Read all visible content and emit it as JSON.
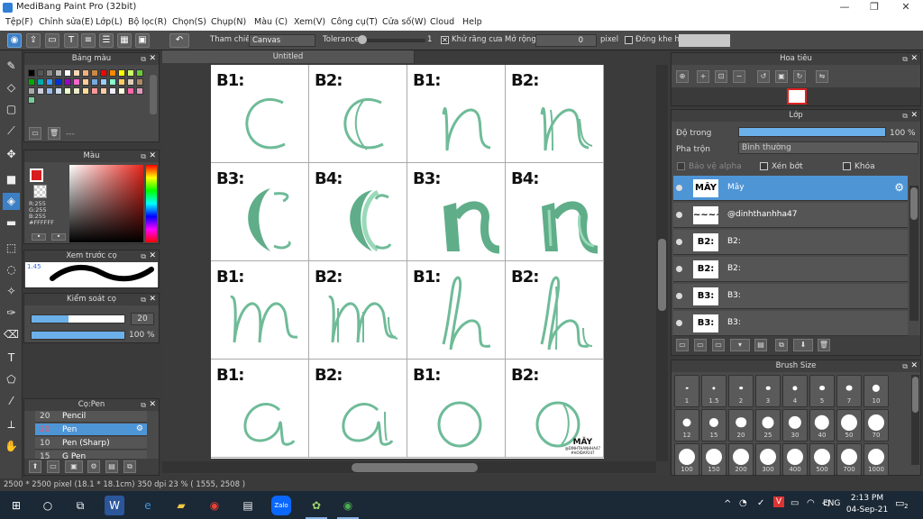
{
  "window": {
    "title": "MediBang Paint Pro (32bit)",
    "min": "—",
    "max": "❐",
    "close": "✕"
  },
  "menu": [
    "Tệp(F)",
    "Chỉnh sửa(E)",
    "Lớp(L)",
    "Bộ lọc(R)",
    "Chọn(S)",
    "Chụp(N)",
    "Màu (C)",
    "Xem(V)",
    "Công cụ(T)",
    "Cửa số(W)",
    "Cloud",
    "Help"
  ],
  "toolbar": {
    "reference_label": "Tham chiếu",
    "reference_value": "Canvas",
    "tolerance_label": "Tolerance",
    "tolerance_value": "1",
    "antialias_label": "Khử răng cưa",
    "expand_label": "Mở rộng",
    "expand_value": "0",
    "expand_unit": "pixel",
    "close_gap_label": "Đóng khe hở"
  },
  "palette_panel": {
    "title": "Bảng màu",
    "footer": "---"
  },
  "color_panel": {
    "title": "Màu",
    "r": "R:255",
    "g": "G:255",
    "b": "B:255",
    "hex": "#FFFFFF",
    "primary_color": "#d81e1e"
  },
  "brush_preview": {
    "title": "Xem trước cọ",
    "size": "1.45"
  },
  "brush_control": {
    "title": "Kiểm soát cọ",
    "size": "20",
    "opacity": "100 %",
    "size_fill": 0.4,
    "opacity_fill": 1.0
  },
  "brush_list": {
    "title": "Cọ:Pen",
    "items": [
      {
        "size": "20",
        "name": "Pencil",
        "selected": false
      },
      {
        "size": "20",
        "name": "Pen",
        "selected": true
      },
      {
        "size": "10",
        "name": "Pen (Sharp)",
        "selected": false
      },
      {
        "size": "15",
        "name": "G Pen",
        "selected": false
      }
    ]
  },
  "document": {
    "tab": "Untitled"
  },
  "canvas": {
    "cells": [
      {
        "label": "B1:",
        "glyph": "c1"
      },
      {
        "label": "B2:",
        "glyph": "c2"
      },
      {
        "label": "B1:",
        "glyph": "n1"
      },
      {
        "label": "B2:",
        "glyph": "n2"
      },
      {
        "label": "B3:",
        "glyph": "c3"
      },
      {
        "label": "B4:",
        "glyph": "c4"
      },
      {
        "label": "B3:",
        "glyph": "n3"
      },
      {
        "label": "B4:",
        "glyph": "n4"
      },
      {
        "label": "B1:",
        "glyph": "m1"
      },
      {
        "label": "B2:",
        "glyph": "m2"
      },
      {
        "label": "B1:",
        "glyph": "h1"
      },
      {
        "label": "B2:",
        "glyph": "h2"
      },
      {
        "label": "B1:",
        "glyph": "a1"
      },
      {
        "label": "B2:",
        "glyph": "a2"
      },
      {
        "label": "B1:",
        "glyph": "o1"
      },
      {
        "label": "B2:",
        "glyph": "o2"
      }
    ],
    "watermark": "MÂY",
    "watermark_line1": "@DINHTHANHHA47",
    "watermark_line2": "#HOIDAP247"
  },
  "status": "2500 * 2500 pixel   (18.1 * 18.1cm)   350 dpi   23 %   ( 1555, 2508 )",
  "navigator": {
    "title": "Hoa tiêu"
  },
  "layer_panel": {
    "title": "Lớp",
    "opacity_label": "Độ trong",
    "opacity_value": "100 %",
    "blend_label": "Pha trộn",
    "blend_value": "Bình thường",
    "protect_alpha": "Bảo vệ alpha",
    "clipping": "Xén bớt",
    "lock": "Khóa",
    "layers": [
      {
        "name": "Mây",
        "thumb": "MÂY",
        "selected": true
      },
      {
        "name": "@dinhthanhha47",
        "thumb": "~~~~",
        "selected": false
      },
      {
        "name": "B2:",
        "thumb": "B2:",
        "selected": false
      },
      {
        "name": "B2:",
        "thumb": "B2:",
        "selected": false
      },
      {
        "name": "B3:",
        "thumb": "B3:",
        "selected": false
      },
      {
        "name": "B3:",
        "thumb": "B3:",
        "selected": false
      }
    ]
  },
  "brush_size_panel": {
    "title": "Brush Size",
    "sizes": [
      "1",
      "1.5",
      "2",
      "3",
      "4",
      "5",
      "7",
      "10",
      "12",
      "15",
      "20",
      "25",
      "30",
      "40",
      "50",
      "70",
      "100",
      "150",
      "200",
      "300",
      "400",
      "500",
      "700",
      "1000"
    ]
  },
  "taskbar": {
    "lang": "ENG",
    "time": "2:13 PM",
    "date": "04-Sep-21",
    "notif": "2"
  }
}
